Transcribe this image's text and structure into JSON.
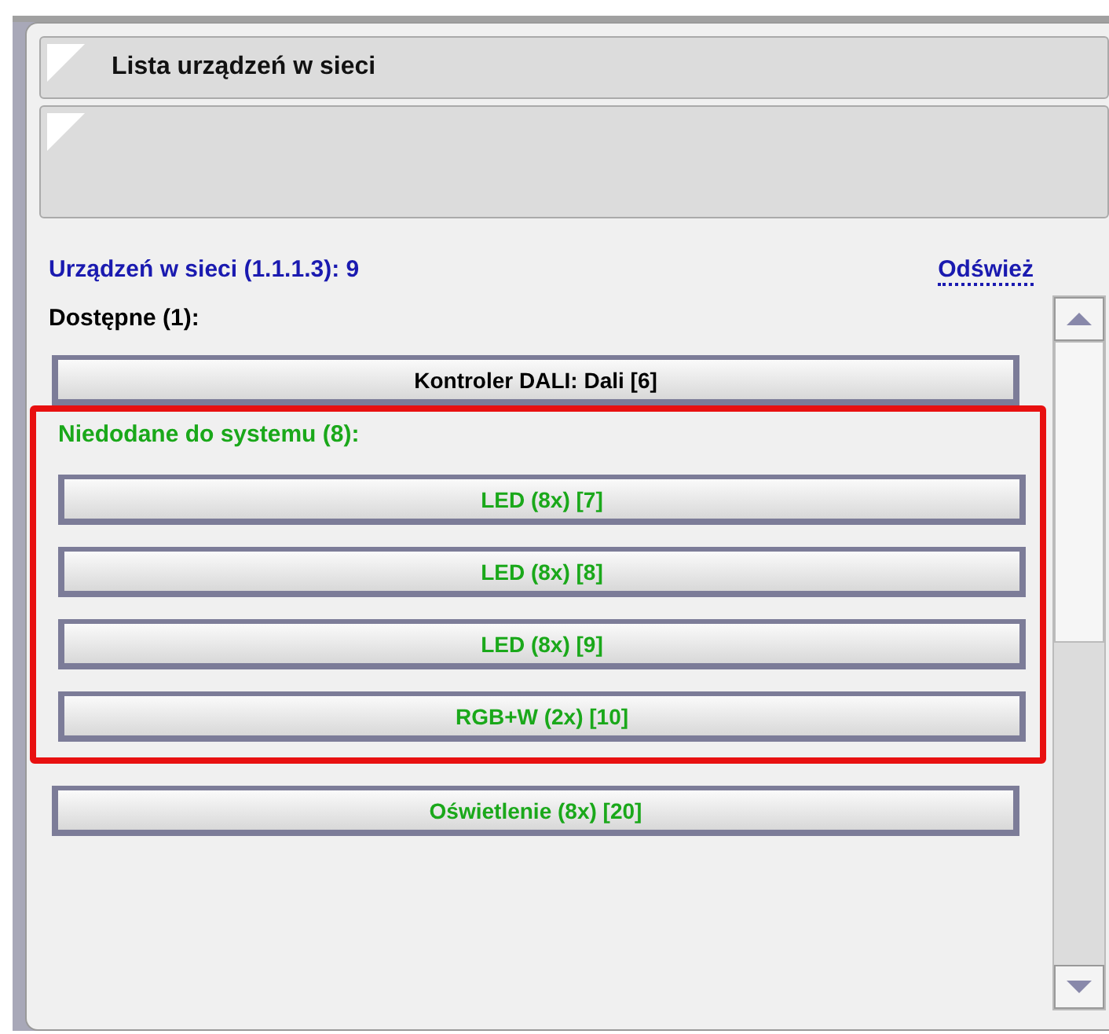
{
  "title_bar": {
    "title": "Lista urządzeń w sieci"
  },
  "summary": {
    "label": "Urządzeń w sieci (1.1.1.3): 9",
    "refresh_link": "Odśwież"
  },
  "sections": [
    {
      "title": "Dostępne (1):",
      "color": "#000000",
      "highlighted": false,
      "devices": [
        {
          "label": "Kontroler DALI: Dali [6]",
          "highlighted": false
        }
      ]
    },
    {
      "title": "Niedodane do systemu (8):",
      "color": "#1aa81a",
      "highlighted": true,
      "devices": [
        {
          "label": "LED (8x) [7]",
          "highlighted": true
        },
        {
          "label": "LED (8x) [8]",
          "highlighted": true
        },
        {
          "label": "LED (8x) [9]",
          "highlighted": true
        },
        {
          "label": "RGB+W (2x) [10]",
          "highlighted": true
        },
        {
          "label": "Oświetlenie (8x) [20]",
          "highlighted": false
        }
      ]
    }
  ]
}
